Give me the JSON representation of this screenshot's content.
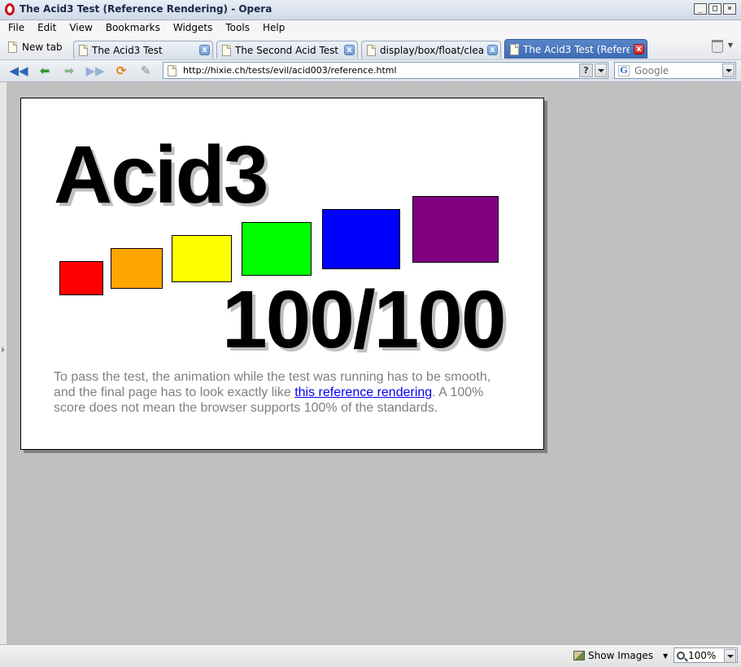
{
  "window": {
    "title": "The Acid3 Test (Reference Rendering) - Opera"
  },
  "menu": [
    {
      "label": "File"
    },
    {
      "label": "Edit"
    },
    {
      "label": "View"
    },
    {
      "label": "Bookmarks"
    },
    {
      "label": "Widgets"
    },
    {
      "label": "Tools"
    },
    {
      "label": "Help"
    }
  ],
  "tabs": {
    "new_tab_label": "New tab",
    "items": [
      {
        "label": "The Acid3 Test",
        "active": false
      },
      {
        "label": "The Second Acid Test",
        "active": false
      },
      {
        "label": "display/box/float/clear ...",
        "active": false
      },
      {
        "label": "The Acid3 Test (Refere...",
        "active": true
      }
    ]
  },
  "address": {
    "url": "http://hixie.ch/tests/evil/acid003/reference.html",
    "help_label": "?",
    "search_engine": "G",
    "search_placeholder": "Google"
  },
  "page": {
    "heading": "Acid3",
    "score": "100/100",
    "boxes": [
      {
        "color": "#ff0000"
      },
      {
        "color": "#ffa500"
      },
      {
        "color": "#ffff00"
      },
      {
        "color": "#00ff00"
      },
      {
        "color": "#0000ff"
      },
      {
        "color": "#800080"
      }
    ],
    "desc_before": "To pass the test, the animation while the test was running has to be smooth, and the final page has to look exactly like ",
    "desc_link": "this reference rendering",
    "desc_after": ". A 100% score does not mean the browser supports 100% of the standards."
  },
  "status": {
    "show_images": "Show Images",
    "zoom": "100%"
  },
  "icons": {
    "back": "rewind-back-icon",
    "prev": "back-arrow-icon",
    "next": "forward-arrow-icon",
    "fastforward": "fast-forward-icon",
    "reload": "reload-icon",
    "edit": "pencil-icon"
  }
}
